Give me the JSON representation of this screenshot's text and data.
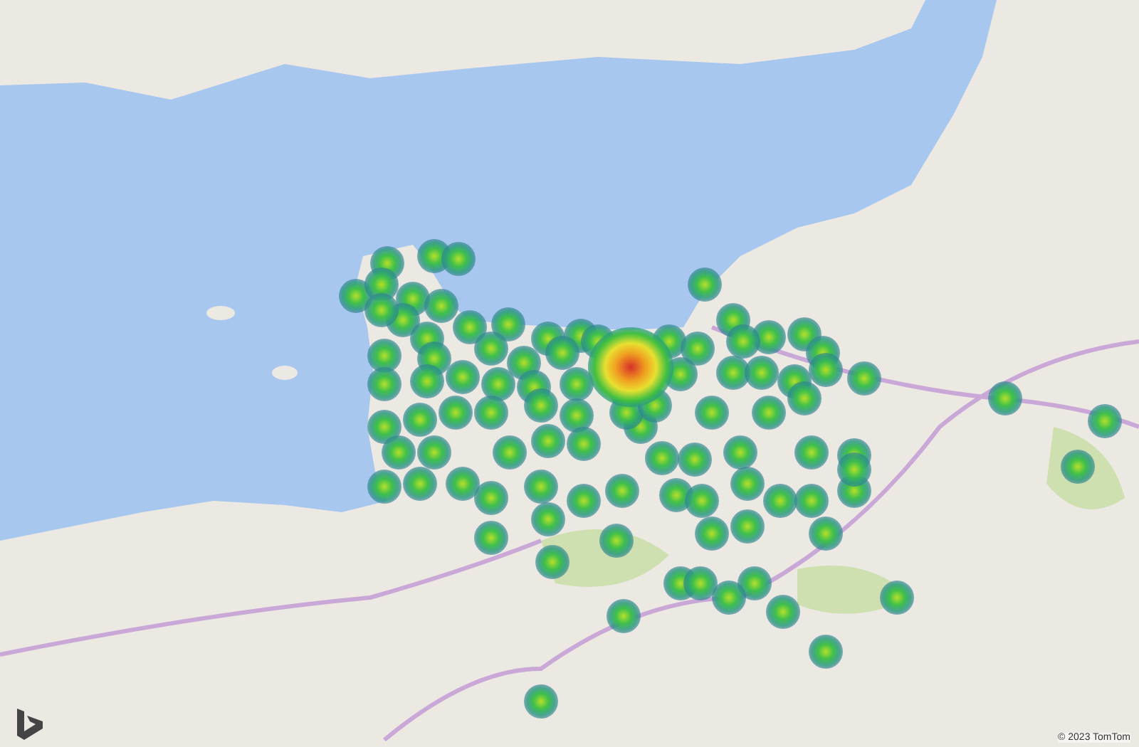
{
  "map": {
    "attribution": "© 2023 TomTom"
  }
}
